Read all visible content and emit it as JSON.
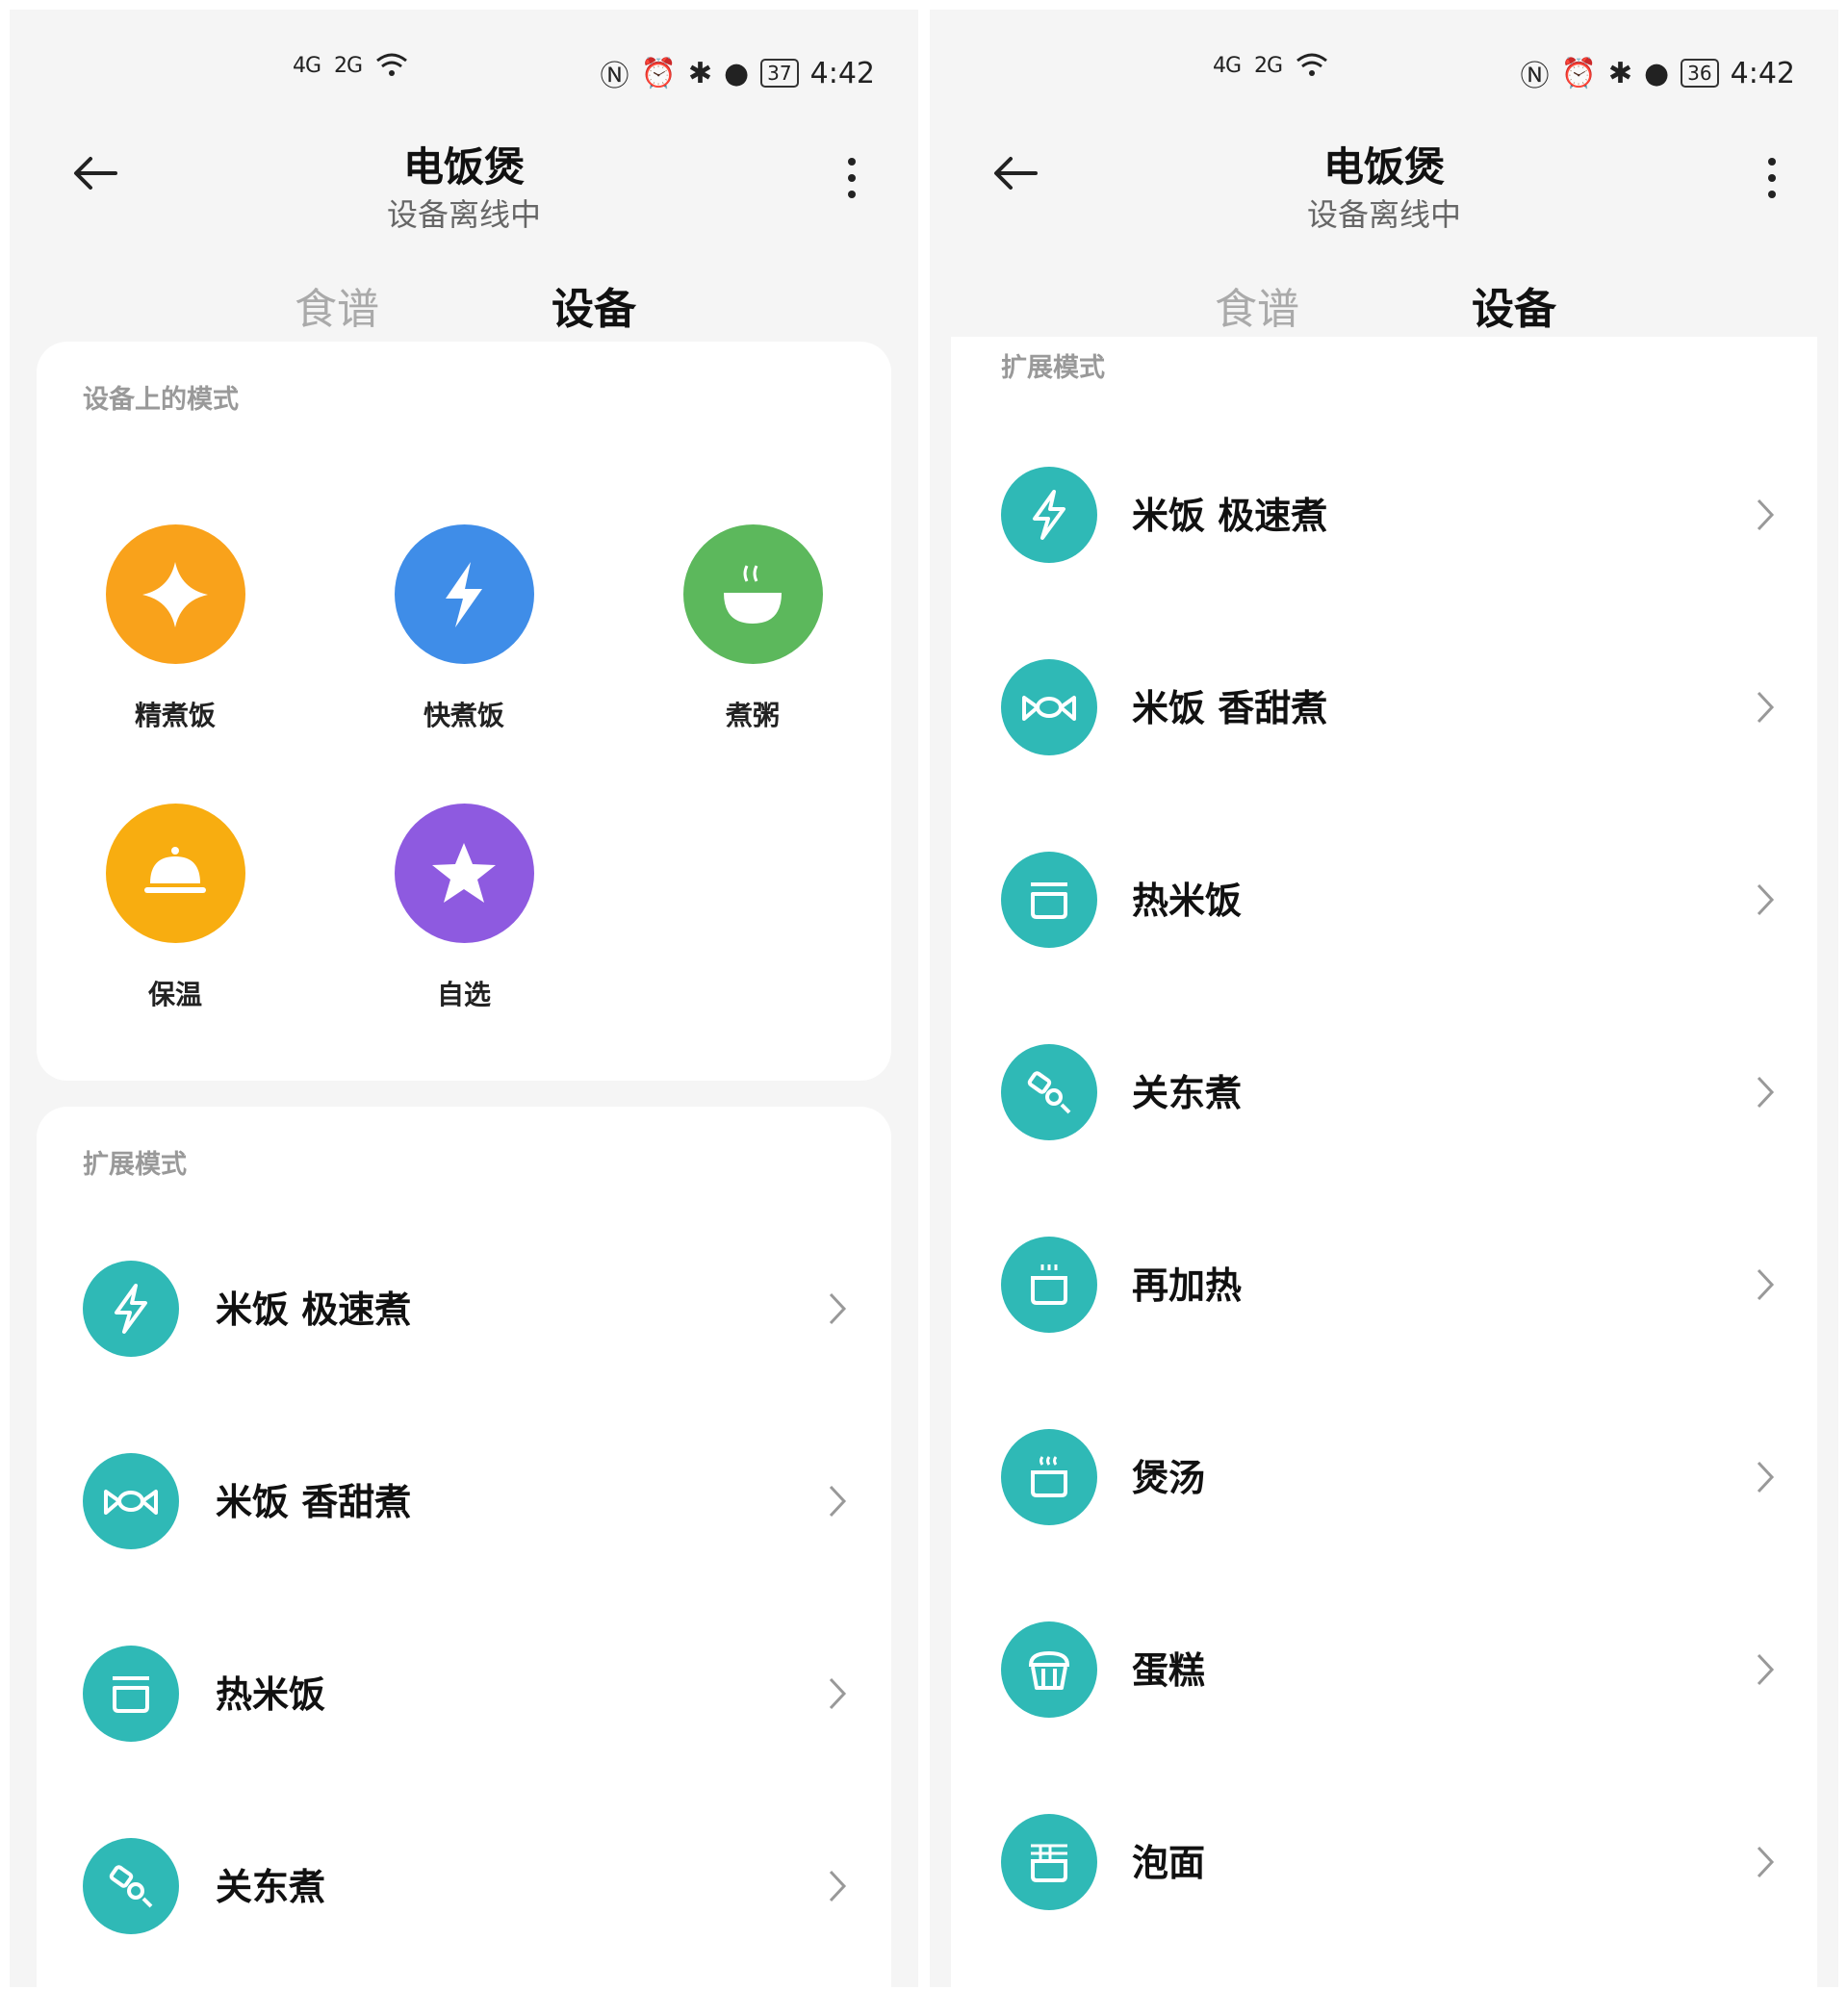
{
  "status_left": {
    "signal1": "4G",
    "signal2": "2G",
    "wifi_icon": "wifi-icon"
  },
  "status_right": {
    "time": "4:42",
    "battery": "37"
  },
  "status_right_b": {
    "time": "4:42",
    "battery": "36"
  },
  "header": {
    "title": "电饭煲",
    "subtitle": "设备离线中"
  },
  "tabs": {
    "recipes": "食谱",
    "device": "设备"
  },
  "device_modes": {
    "section_title": "设备上的模式",
    "items": [
      {
        "label": "精煮饭",
        "icon": "sparkle-icon",
        "color": "#f9a21b"
      },
      {
        "label": "快煮饭",
        "icon": "lightning-icon",
        "color": "#3f8de8"
      },
      {
        "label": "煮粥",
        "icon": "bowl-icon",
        "color": "#5cb85c"
      },
      {
        "label": "保温",
        "icon": "dome-icon",
        "color": "#f8ad10"
      },
      {
        "label": "自选",
        "icon": "star-icon",
        "color": "#8e5ae0"
      }
    ]
  },
  "ext_modes": {
    "section_title": "扩展模式",
    "items": [
      {
        "label": "米饭 极速煮",
        "icon": "lightning-icon"
      },
      {
        "label": "米饭 香甜煮",
        "icon": "candy-icon"
      },
      {
        "label": "热米饭",
        "icon": "pot-icon"
      },
      {
        "label": "关东煮",
        "icon": "skewer-icon"
      },
      {
        "label": "再加热",
        "icon": "steam-pot-icon"
      },
      {
        "label": "煲汤",
        "icon": "soup-pot-icon"
      },
      {
        "label": "蛋糕",
        "icon": "cake-icon"
      },
      {
        "label": "泡面",
        "icon": "noodle-icon"
      }
    ]
  },
  "colors": {
    "teal": "#2fb9b6"
  }
}
